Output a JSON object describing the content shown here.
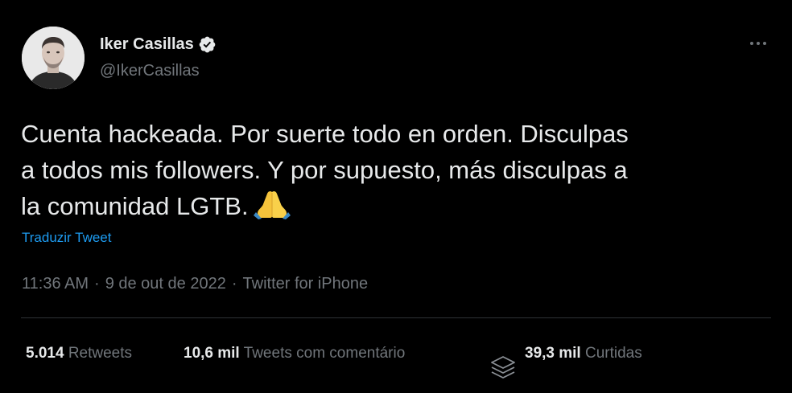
{
  "author": {
    "display_name": "Iker Casillas",
    "handle": "@IkerCasillas",
    "verified": true
  },
  "tweet": {
    "text": "Cuenta hackeada. Por suerte todo en orden. Disculpas\na todos mis followers. Y por supuesto, más disculpas a\nla comunidad LGTB.",
    "emoji": "🙏",
    "translate_label": "Traduzir Tweet",
    "time": "11:36 AM",
    "date": "9 de out de 2022",
    "separator": "·",
    "source": "Twitter for iPhone"
  },
  "stats": {
    "retweets": {
      "value": "5.014",
      "label": "Retweets"
    },
    "quotes": {
      "value": "10,6 mil",
      "label": "Tweets com comentário"
    },
    "likes": {
      "value": "39,3 mil",
      "label": "Curtidas"
    }
  },
  "icons": {
    "avatar": "avatar-photo",
    "verified": "verified-badge-icon",
    "more": "more-options-icon",
    "emoji": "folded-hands-emoji",
    "watermark": "layers-icon"
  },
  "colors": {
    "background": "#000000",
    "text": "#e7e9ea",
    "muted": "#71767b",
    "link": "#1d9bf0",
    "divider": "#2f3336"
  }
}
